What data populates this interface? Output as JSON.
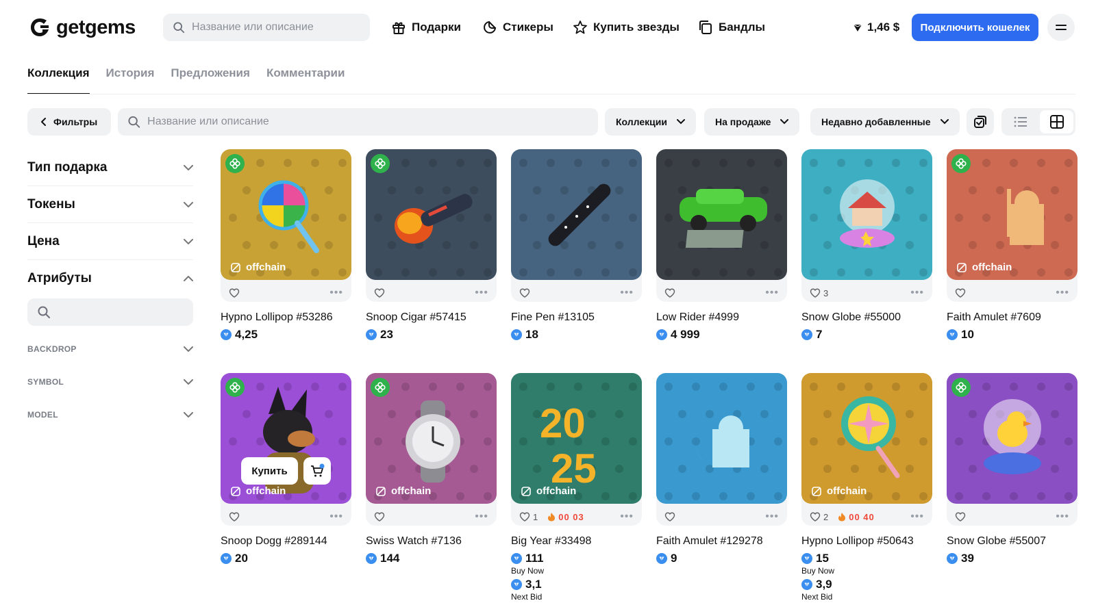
{
  "header": {
    "logo_text": "getgems",
    "search_placeholder": "Название или описание",
    "nav": [
      {
        "label": "Подарки",
        "icon": "gift-icon"
      },
      {
        "label": "Стикеры",
        "icon": "sticker-icon"
      },
      {
        "label": "Купить звезды",
        "icon": "star-icon"
      },
      {
        "label": "Бандлы",
        "icon": "bundle-icon"
      }
    ],
    "balance": "1,46 $",
    "connect_label": "Подключить кошелек"
  },
  "tabs": [
    "Коллекция",
    "История",
    "Предложения",
    "Комментарии"
  ],
  "toolbar": {
    "filters_label": "Фильтры",
    "search_placeholder": "Название или описание",
    "collections_label": "Коллекции",
    "status_label": "На продаже",
    "sort_label": "Недавно добавленные"
  },
  "sidebar": {
    "sections": [
      "Тип подарка",
      "Токены",
      "Цена",
      "Атрибуты"
    ],
    "attributes": [
      "BACKDROP",
      "SYMBOL",
      "MODEL"
    ]
  },
  "labels": {
    "offchain": "offchain",
    "buy": "Купить",
    "buy_now": "Buy Now",
    "next_bid": "Next Bid"
  },
  "colors": {
    "accent": "#2d6cf0",
    "ton_blue": "#3a8ef0",
    "green_badge": "#2fb24c",
    "timer_red": "#ef4a3a"
  },
  "items": [
    {
      "name": "Hypno Lollipop #53286",
      "price": "4,25",
      "likes": "",
      "bg": "#c9a236",
      "green_badge": true,
      "offchain": true
    },
    {
      "name": "Snoop Cigar #57415",
      "price": "23",
      "likes": "",
      "bg": "#3e4d5e",
      "green_badge": true,
      "offchain": false
    },
    {
      "name": "Fine Pen #13105",
      "price": "18",
      "likes": "",
      "bg": "#46637f",
      "green_badge": false,
      "offchain": false
    },
    {
      "name": "Low Rider #4999",
      "price": "4 999",
      "likes": "",
      "bg": "#3a3f46",
      "green_badge": false,
      "offchain": false
    },
    {
      "name": "Snow Globe #55000",
      "price": "7",
      "likes": "3",
      "bg": "#3eaec2",
      "green_badge": false,
      "offchain": false
    },
    {
      "name": "Faith Amulet #7609",
      "price": "10",
      "likes": "",
      "bg": "#cf6a52",
      "green_badge": true,
      "offchain": true
    },
    {
      "name": "Snoop Dogg #289144",
      "price": "20",
      "likes": "",
      "bg": "#9b4fd6",
      "green_badge": true,
      "offchain": true,
      "buy": true
    },
    {
      "name": "Swiss Watch #7136",
      "price": "144",
      "likes": "",
      "bg": "#a65a93",
      "green_badge": true,
      "offchain": true
    },
    {
      "name": "Big Year #33498",
      "price": "111",
      "likes": "1",
      "timer": "00 03",
      "bid": "3,1",
      "bg": "#2f7d6a",
      "green_badge": false,
      "offchain": true
    },
    {
      "name": "Faith Amulet #129278",
      "price": "9",
      "likes": "",
      "bg": "#3a9ad0",
      "green_badge": false,
      "offchain": false
    },
    {
      "name": "Hypno Lollipop #50643",
      "price": "15",
      "likes": "2",
      "timer": "00 40",
      "bid": "3,9",
      "bg": "#cf9a2e",
      "green_badge": false,
      "offchain": true
    },
    {
      "name": "Snow Globe #55007",
      "price": "39",
      "likes": "",
      "bg": "#8a4fc2",
      "green_badge": true,
      "offchain": false
    }
  ]
}
